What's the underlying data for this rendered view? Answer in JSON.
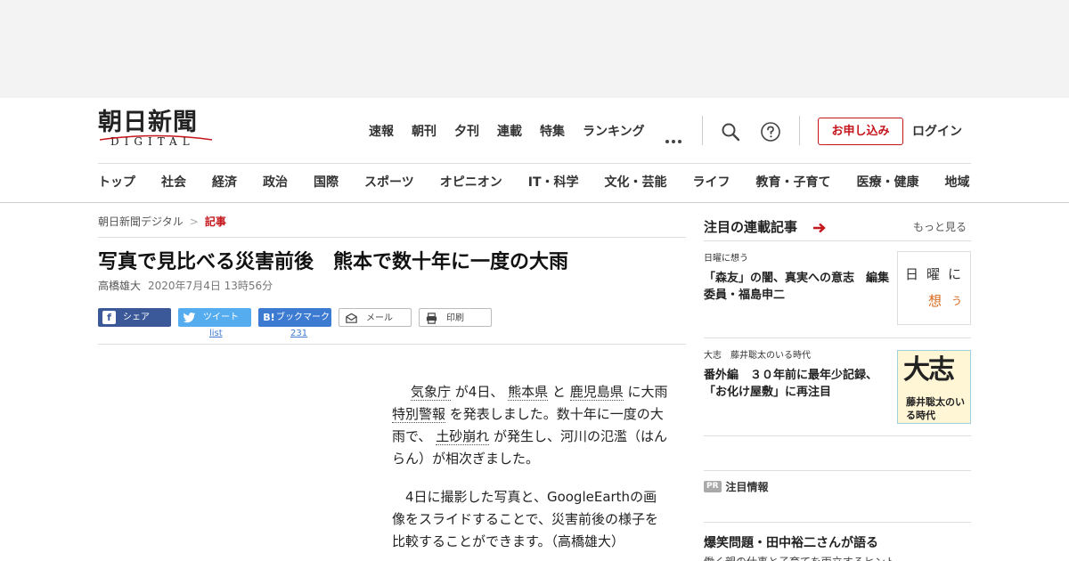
{
  "brand": {
    "logo_main": "朝日新聞",
    "logo_sub": "DIGITAL"
  },
  "topnav": [
    "速報",
    "朝刊",
    "夕刊",
    "連載",
    "特集",
    "ランキング"
  ],
  "header": {
    "apply_label": "お申し込み",
    "login_label": "ログイン"
  },
  "catnav": [
    "トップ",
    "社会",
    "経済",
    "政治",
    "国際",
    "スポーツ",
    "オピニオン",
    "IT・科学",
    "文化・芸能",
    "ライフ",
    "教育・子育て",
    "医療・健康",
    "地域"
  ],
  "breadcrumb": {
    "home": "朝日新聞デジタル",
    "sep": ">",
    "current": "記事"
  },
  "article": {
    "headline": "写真で見比べる災害前後　熊本で数十年に一度の大雨",
    "author": "高橋雄大",
    "date": "2020年7月4日 13時56分",
    "p1": {
      "k1": "気象庁",
      "t1": "が4日、",
      "k2": "熊本県",
      "t2": "と",
      "k3": "鹿児島県",
      "t3": "に大雨",
      "k4": "特別警報",
      "t4": "を発表しました。数十年に一度の大雨で、",
      "k5": "土砂崩れ",
      "t5": "が発生し、河川の氾濫（はんらん）が相次ぎました。"
    },
    "p2": "4日に撮影した写真と、GoogleEarthの画像をスライドすることで、災害前後の様子を比較することができます。（高橋雄大）"
  },
  "share": {
    "facebook": "シェア",
    "twitter": "ツイート",
    "twitter_count": "list",
    "hatena": "ブックマーク",
    "hatena_icon": "B!",
    "hatena_count": "231",
    "mail": "メール",
    "print": "印刷"
  },
  "sidebar": {
    "title": "注目の連載記事",
    "more": "もっと見る",
    "items": [
      {
        "kicker": "日曜に想う",
        "title": "「森友」の闇、真実への意志　編集委員・福島申二",
        "thumb_line1": "日曜に",
        "thumb_omo": "想",
        "thumb_u": "う"
      },
      {
        "kicker": "大志　藤井聡太のいる時代",
        "title": "番外編　３０年前に最年少記録、「お化け屋敷」に再注目",
        "thumb_big": "大志",
        "thumb_sub": "藤井聡太のいる時代"
      }
    ],
    "pr_badge": "PR",
    "pr_label": "注目情報",
    "pr_head": "爆笑問題・田中裕二さんが語る",
    "pr_sub": "働く親の仕事と子育てを両立するヒント"
  },
  "colors": {
    "accent_red": "#c4161c",
    "facebook": "#3b5998",
    "twitter": "#55acee",
    "hatena": "#3d7bd2"
  }
}
